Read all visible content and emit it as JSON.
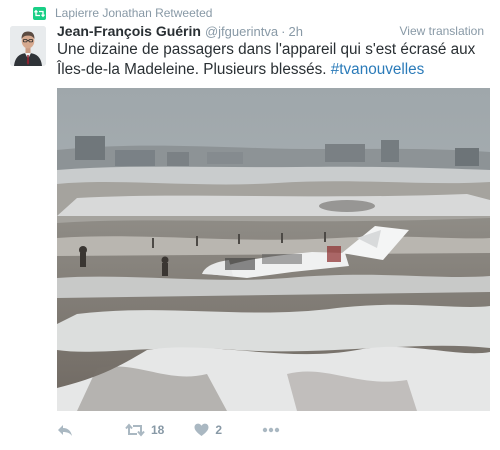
{
  "context": {
    "text": "Lapierre Jonathan Retweeted",
    "icon": "retweet-icon",
    "accent": "#19cf86"
  },
  "author": {
    "name": "Jean-François Guérin",
    "handle": "@jfguerintva",
    "time": "2h"
  },
  "translate_label": "View translation",
  "text": {
    "main": "Une dizaine de passagers dans l'appareil qui s'est écrasé aux Îles-de-la Madeleine. Plusieurs blessés.",
    "hashtag": "#tvanouvelles"
  },
  "actions": {
    "reply_icon": "reply-icon",
    "retweet_icon": "retweet-icon",
    "retweet_count": "18",
    "like_icon": "heart-icon",
    "like_count": "2",
    "more_icon": "more-icon"
  },
  "colors": {
    "link": "#2b7bb9",
    "muted": "#8899a6",
    "text": "#292f33"
  }
}
